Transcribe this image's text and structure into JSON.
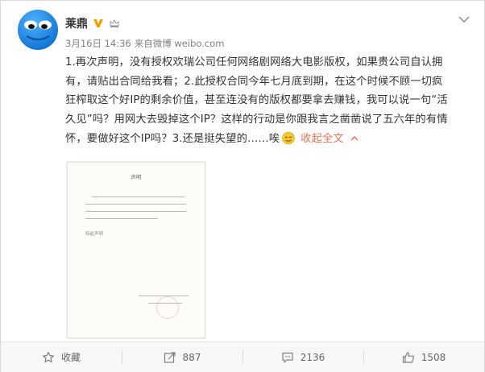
{
  "post": {
    "author": "莱鼎",
    "meta_date": "3月16日 14:36",
    "meta_from_label": "来自",
    "meta_source": "微博 weibo.com",
    "paragraph_lines": [
      "1.再次声明，没有授权欢瑞公司任何网络剧网络大电影版权，如果贵公司自认拥",
      "有，请贴出合同给我看；2.此授权合同今年七月底到期，在这个时候不顾一切疯",
      "狂榨取这个好IP的剩余价值，甚至连没有的版权都要拿去赚钱，我可以说一句“活",
      "久见”吗？用网大去毁掉这个IP？这样的行动是你跟我言之凿凿说了五六年的有情",
      "怀，要做好这个IP吗？3.还是挺失望的……唉"
    ],
    "expand_label": "收起全文",
    "document": {
      "title": "声明",
      "signature": "特此声明"
    }
  },
  "actions": {
    "favorite_label": "收藏",
    "repost_count": "887",
    "comment_count": "2136",
    "like_count": "1508"
  },
  "colors": {
    "link": "#eb7350",
    "verified": "#f0a000",
    "avatar_blue": "#1a8ee8",
    "text": "#333333",
    "meta": "#808080"
  },
  "icons": {
    "avatar": "blue-monster-face",
    "verified": "verified-v-badge",
    "level": "crown-icon",
    "menu": "chevron-down-icon",
    "emoji": "sweat-smile-emoji",
    "favorite": "star-icon",
    "repost": "share-arrow-icon",
    "comment": "comment-bubble-icon",
    "like": "thumbs-up-icon"
  }
}
